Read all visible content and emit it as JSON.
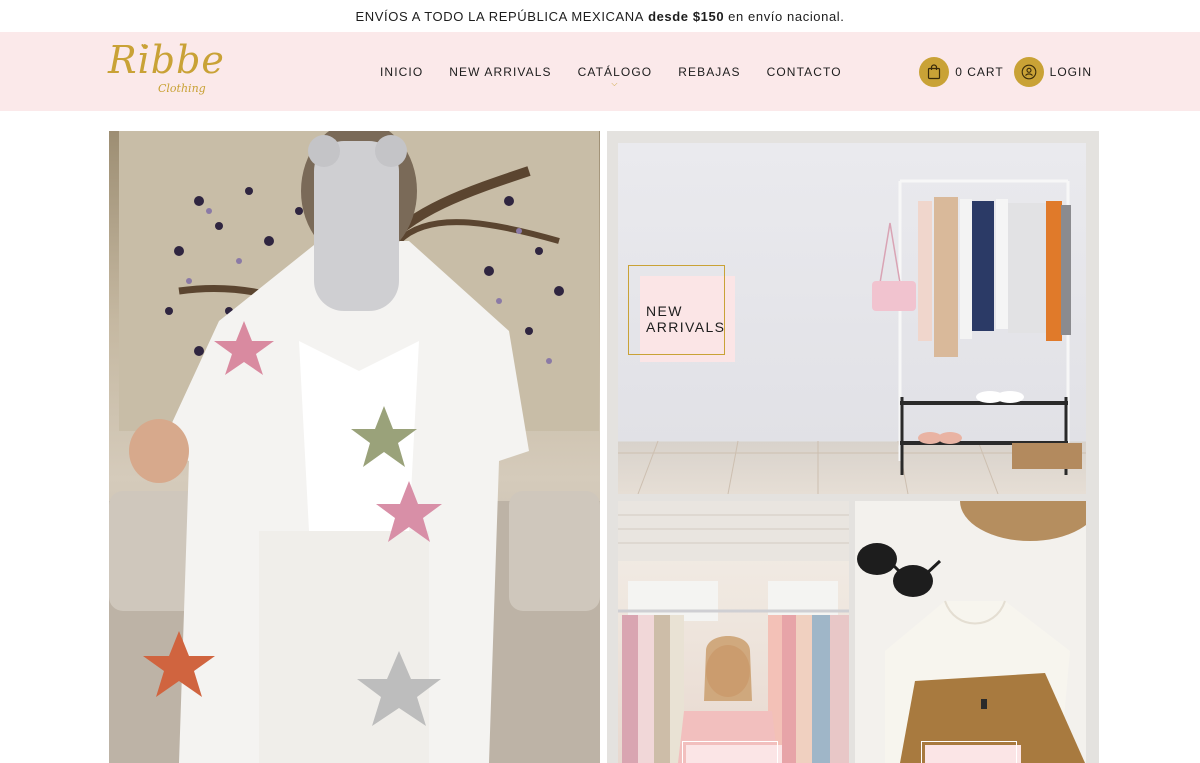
{
  "announcement": {
    "lead": "ENVÍOS A TODO LA REPÚBLICA MEXICANA",
    "bold": "desde $150",
    "tail": "en envío nacional."
  },
  "brand": {
    "logo_main": "Ribbe",
    "logo_sub": "Clothing",
    "accent": "#c9a236",
    "header_bg": "#fbe9ea"
  },
  "nav": {
    "items": [
      {
        "label": "INICIO"
      },
      {
        "label": "NEW ARRIVALS"
      },
      {
        "label": "CATÁLOGO"
      },
      {
        "label": "REBAJAS"
      },
      {
        "label": "CONTACTO"
      }
    ]
  },
  "account": {
    "cart_label": "0 CART",
    "login_label": "LOGIN"
  },
  "tiles": {
    "new_arrivals_label": "NEW ARRIVALS"
  }
}
